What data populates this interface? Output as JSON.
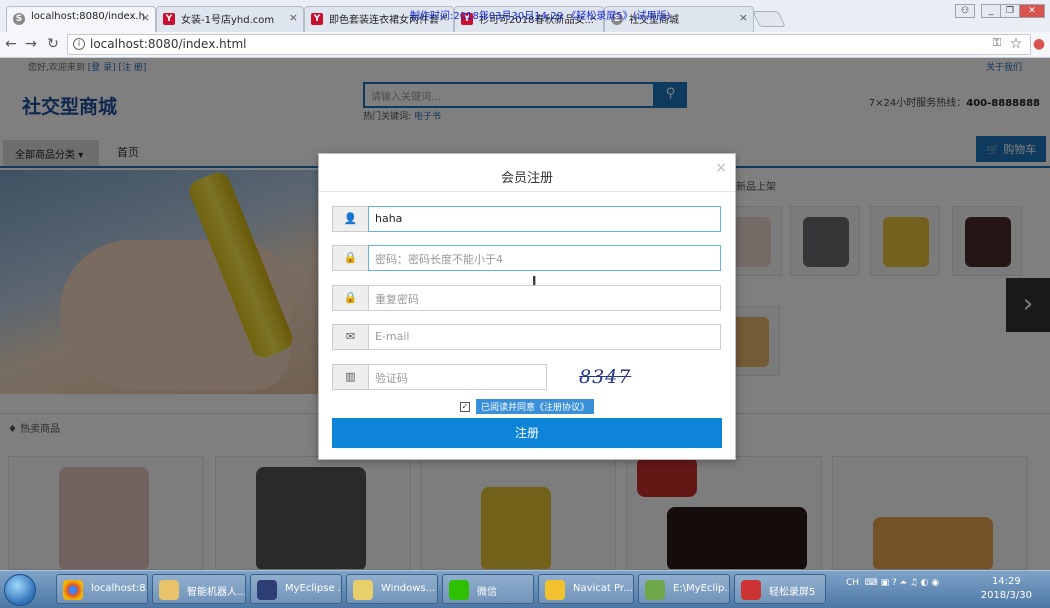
{
  "browser": {
    "tabs": [
      {
        "title": "localhost:8080/index.h",
        "icon": "globe-icon"
      },
      {
        "title": "女装-1号店yhd.com",
        "icon": "yhd-icon"
      },
      {
        "title": "即色套装连衣裙女两件套",
        "icon": "yhd-icon"
      },
      {
        "title": "衫可可2018春秋新品女...",
        "icon": "yhd-icon"
      },
      {
        "title": "社交型商城",
        "icon": "globe-icon"
      }
    ],
    "url": "localhost:8080/index.html",
    "watermark": "制作时间:2018年03月30日14:29 《轻松录屏5》(试用版)"
  },
  "site": {
    "welcome": "您好,欢迎来到",
    "login_link": "[登 录]",
    "register_link": "[注 册]",
    "about": "关于我们",
    "logo": "社交型商城",
    "search_placeholder": "请输入关键词...",
    "hot_keywords_label": "热门关键词:",
    "hot_keyword": "电子书",
    "hotline_label": "7×24小时服务热线：",
    "hotline_number": "400-8888888",
    "category_button": "全部商品分类",
    "home_link": "首页",
    "cart_button": "购物车",
    "new_section": "新品上架",
    "hot_section": "热卖商品"
  },
  "modal": {
    "title": "会员注册",
    "close": "×",
    "username_value": "haha",
    "password_placeholder": "密码：密码长度不能小于4",
    "repeat_placeholder": "重复密码",
    "email_placeholder": "E-mail",
    "captcha_placeholder": "验证码",
    "captcha_text": "8347",
    "agree_label": "已阅读并同意《注册协议》",
    "submit_label": "注册"
  },
  "taskbar": {
    "items": [
      "localhost:8...",
      "智能机器人...",
      "MyEclipse ...",
      "Windows...",
      "微信",
      "Navicat Pr...",
      "E:\\MyEclip...",
      "轻松录屏5"
    ],
    "tray_lang": "CH",
    "time": "14:29",
    "date": "2018/3/30"
  },
  "colors": {
    "primary": "#1b75bb",
    "submit": "#0d84d8"
  }
}
